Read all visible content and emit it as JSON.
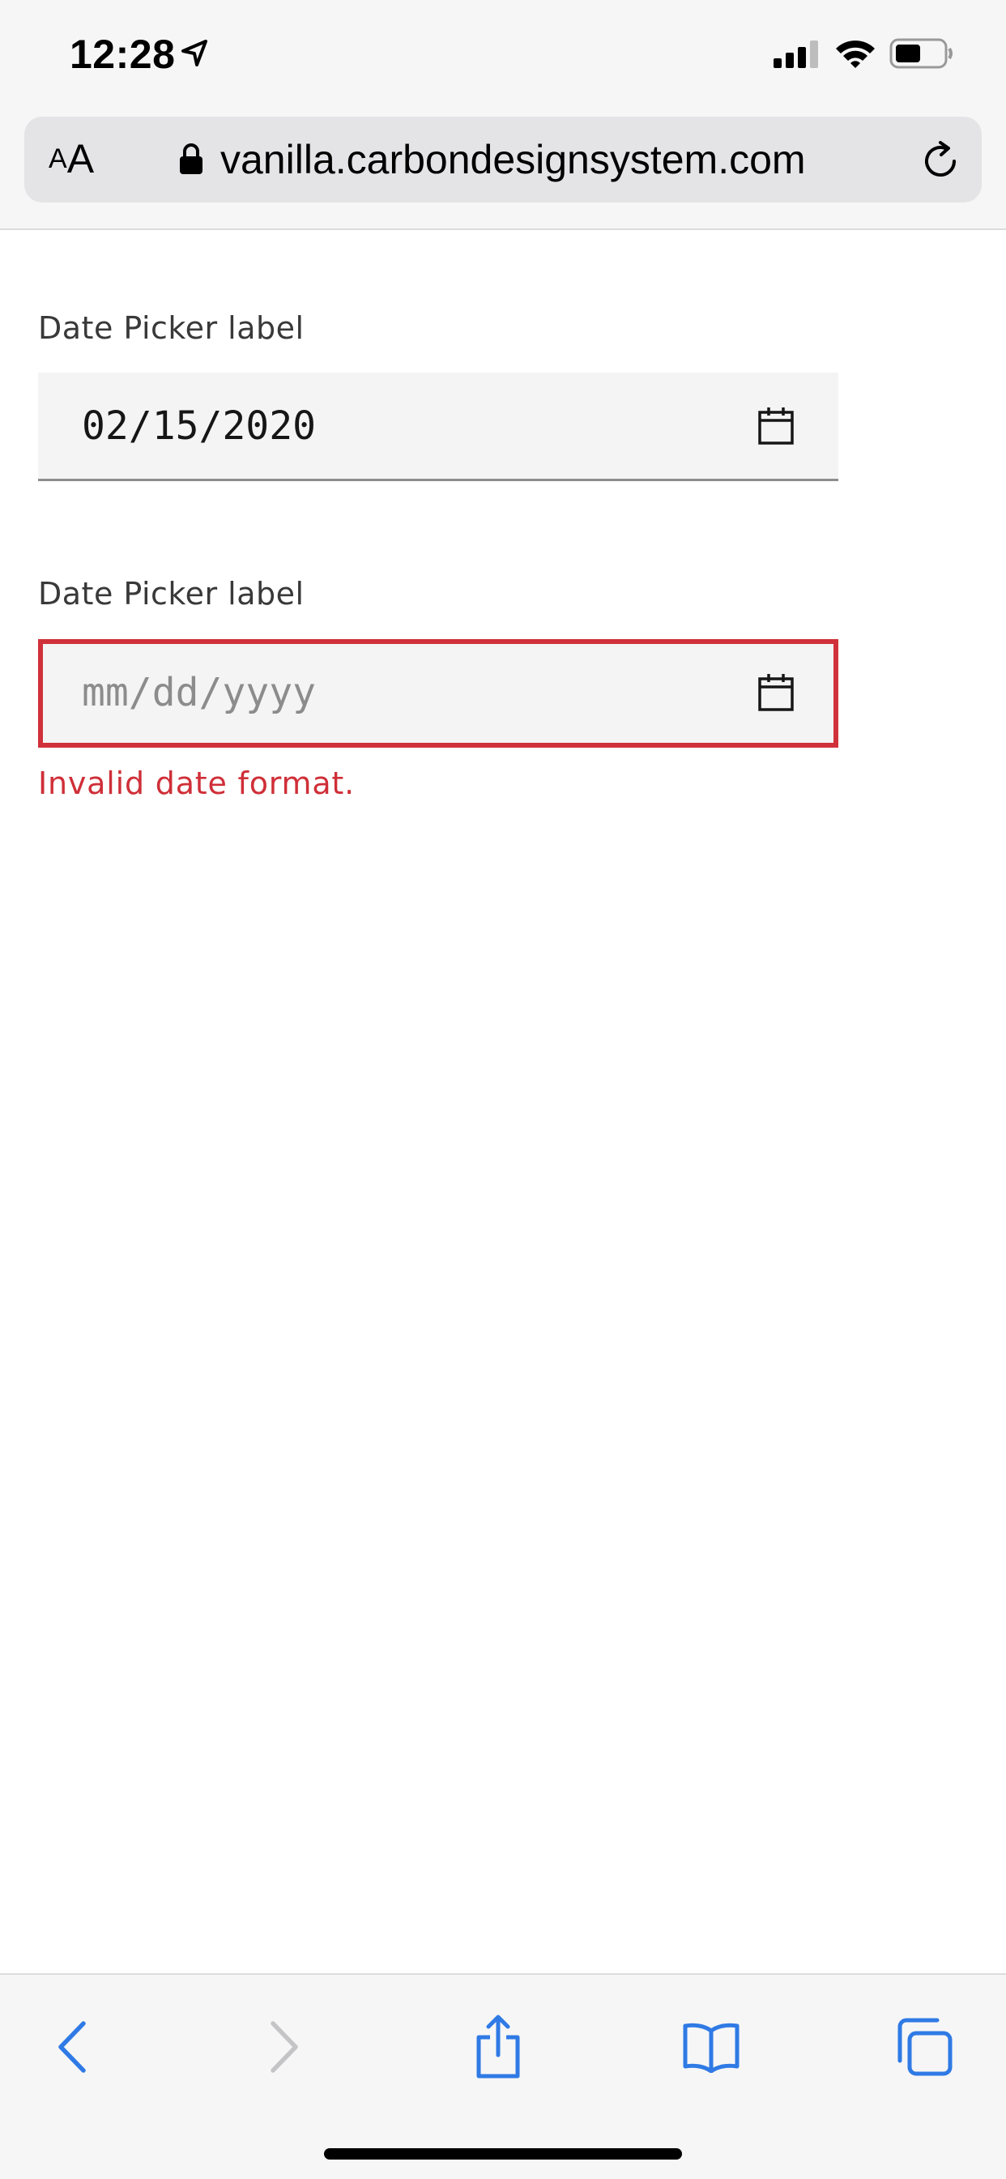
{
  "status_bar": {
    "time": "12:28"
  },
  "browser": {
    "text_size_small": "A",
    "text_size_large": "A",
    "url": "vanilla.carbondesignsystem.com"
  },
  "date_pickers": [
    {
      "label": "Date Picker label",
      "value": "02/15/2020",
      "icon": "calendar-icon"
    },
    {
      "label": "Date Picker label",
      "placeholder": "mm/dd/yyyy",
      "icon": "calendar-icon",
      "error": "Invalid date format."
    }
  ],
  "toolbar": {
    "icons": [
      "back-icon",
      "forward-icon",
      "share-icon",
      "bookmarks-icon",
      "tabs-icon"
    ]
  },
  "colors": {
    "error": "#da1e28",
    "field_bg": "#f4f4f4",
    "safari_blue": "#1a73e8"
  }
}
